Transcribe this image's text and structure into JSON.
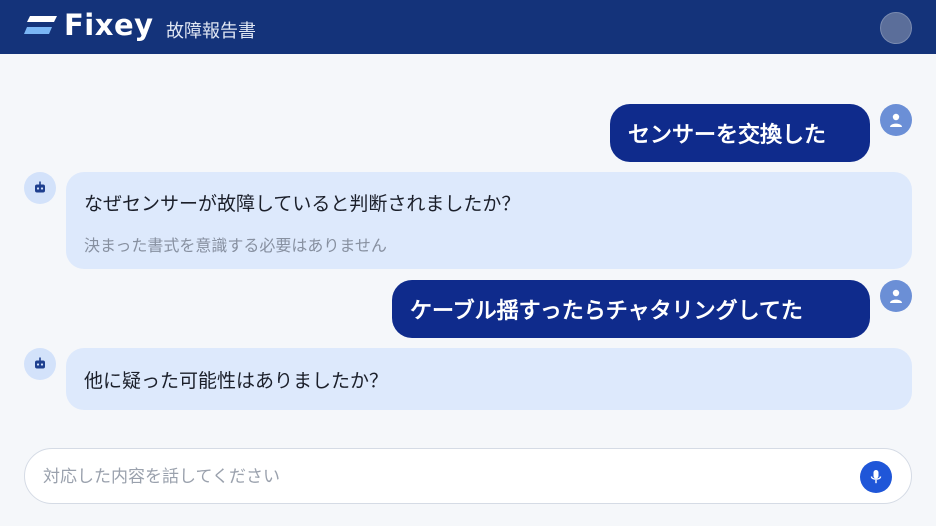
{
  "header": {
    "brand": "Fixey",
    "subtitle": "故障報告書"
  },
  "messages": [
    {
      "role": "user",
      "text": "センサーを交換した"
    },
    {
      "role": "bot",
      "text": "なぜセンサーが故障していると判断されましたか？",
      "hint": "決まった書式を意識する必要はありません"
    },
    {
      "role": "user",
      "text": "ケーブル揺すったらチャタリングしてた"
    },
    {
      "role": "bot",
      "text": "他に疑った可能性はありましたか？"
    }
  ],
  "input": {
    "placeholder": "対応した内容を話してください",
    "value": ""
  },
  "icons": {
    "logo": "fixey-logo-icon",
    "user_avatar": "user-icon",
    "bot_avatar": "robot-icon",
    "mic": "microphone-icon",
    "header_avatar": "avatar"
  },
  "colors": {
    "header_bg": "#14337a",
    "user_bubble": "#0f2b8c",
    "bot_bubble": "#dde9fc",
    "mic_button": "#1f56d8",
    "logo_light": "#7ab6f5"
  }
}
